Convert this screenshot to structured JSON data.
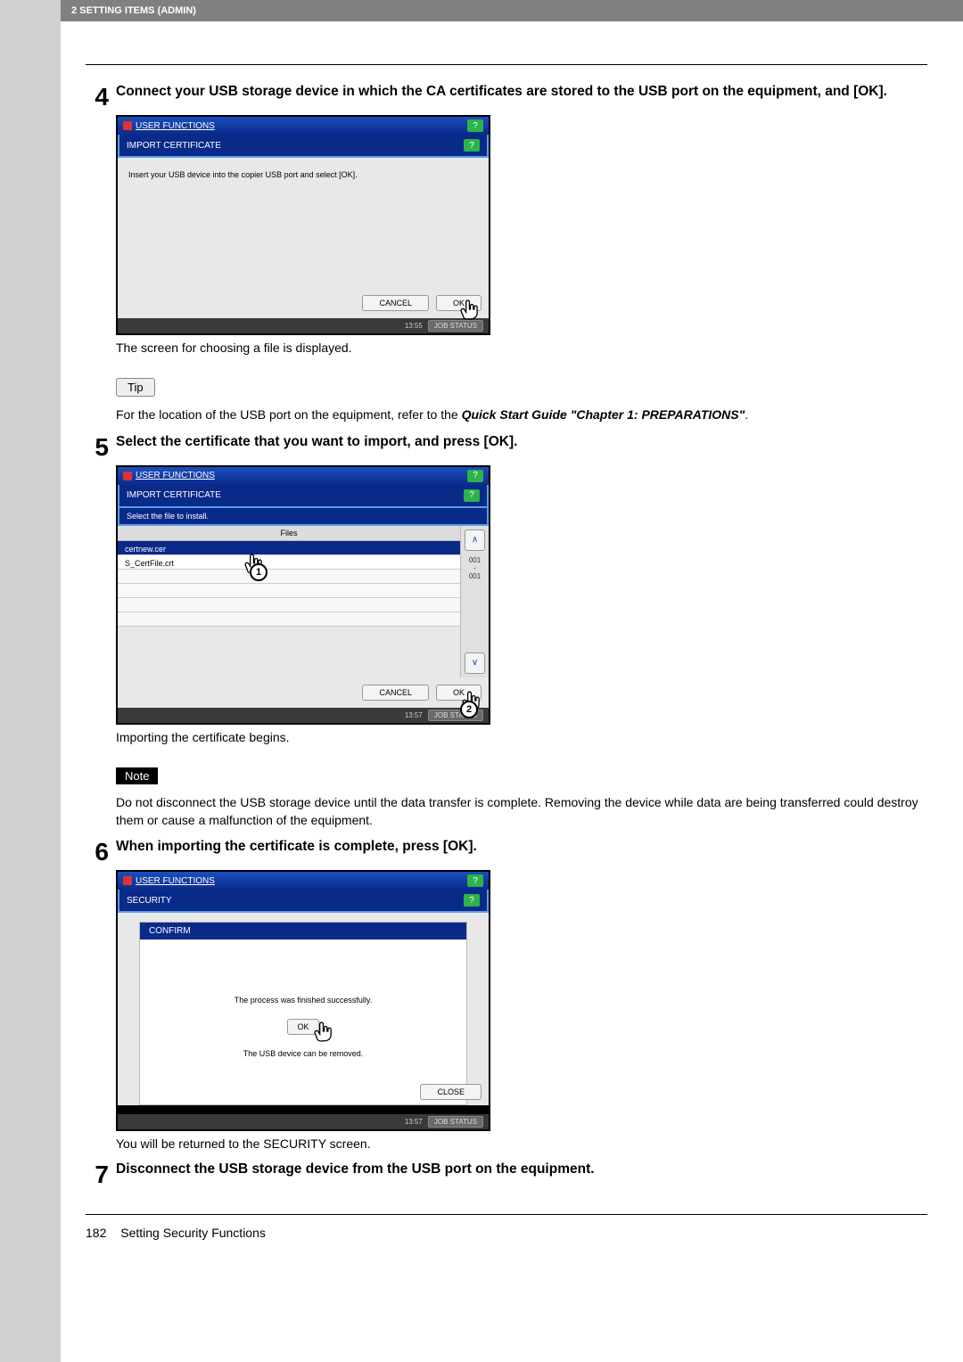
{
  "header": {
    "section": "2 SETTING ITEMS (ADMIN)"
  },
  "step4": {
    "num": "4",
    "title": "Connect your USB storage device in which the CA certificates are stored to the USB port on the equipment, and [OK].",
    "caption": "The screen for choosing a file is displayed.",
    "tip_label": "Tip",
    "tip_text_1": "For the location of the USB port on the equipment, refer to the ",
    "tip_ref": "Quick Start Guide \"Chapter 1: PREPARATIONS\"",
    "tip_text_2": "."
  },
  "step5": {
    "num": "5",
    "title": "Select the certificate that you want to import, and press [OK].",
    "caption": "Importing the certificate begins.",
    "note_label": "Note",
    "note_text": "Do not disconnect the USB storage device until the data transfer is complete. Removing the device while data are being transferred could destroy them or cause a malfunction of the equipment."
  },
  "step6": {
    "num": "6",
    "title": "When importing the certificate is complete, press [OK].",
    "caption": "You will be returned to the SECURITY screen."
  },
  "step7": {
    "num": "7",
    "title": "Disconnect the USB storage device from the USB port on the equipment."
  },
  "screen1": {
    "titlebar": "USER FUNCTIONS",
    "sub": "IMPORT CERTIFICATE",
    "msg": "Insert your USB device into the copier USB port and select [OK].",
    "cancel": "CANCEL",
    "ok": "OK",
    "time": "13:55",
    "job": "JOB STATUS"
  },
  "screen2": {
    "titlebar": "USER FUNCTIONS",
    "sub": "IMPORT CERTIFICATE",
    "instruction": "Select the file to install.",
    "files_header": "Files",
    "file1": "certnew.cer",
    "file2": "S_CertFile.crt",
    "pageind_a": "001",
    "pageind_b": "001",
    "cancel": "CANCEL",
    "ok": "OK",
    "time": "13:57",
    "job": "JOB STATUS",
    "badge1": "1",
    "badge2": "2"
  },
  "screen3": {
    "titlebar": "USER FUNCTIONS",
    "sub": "SECURITY",
    "confirm": "CONFIRM",
    "msg": "The process was finished successfully.",
    "ok": "OK",
    "removed": "The USB device can be removed.",
    "close": "CLOSE",
    "time": "13:57",
    "job": "JOB STATUS"
  },
  "footer": {
    "page": "182",
    "title": "Setting Security Functions"
  }
}
